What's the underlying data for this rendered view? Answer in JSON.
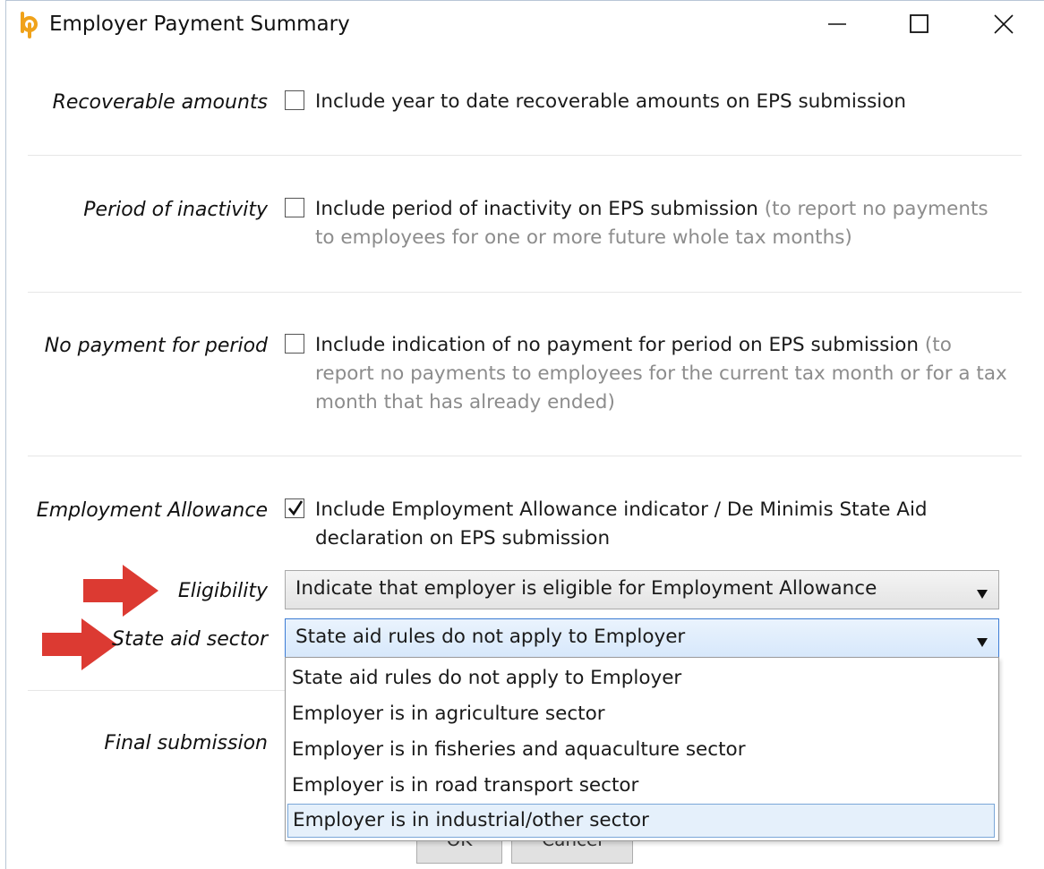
{
  "window": {
    "title": "Employer Payment Summary",
    "app_icon": "bp-logo-icon",
    "controls": [
      "minimize-icon",
      "maximize-icon",
      "close-icon"
    ]
  },
  "rows": {
    "recoverable": {
      "label": "Recoverable amounts",
      "checked": false,
      "text": "Include year to date recoverable amounts on EPS submission",
      "hint": ""
    },
    "inactivity": {
      "label": "Period of inactivity",
      "checked": false,
      "text": "Include period of inactivity on EPS submission",
      "hint": "(to report no payments to employees for one or more future whole tax months)"
    },
    "no_payment": {
      "label": "No payment for period",
      "checked": false,
      "text": "Include indication of no payment for period on EPS submission",
      "hint": "(to report no payments to employees for the current tax month or for a tax month that has already ended)"
    },
    "allowance": {
      "label": "Employment Allowance",
      "checked": true,
      "text": "Include Employment Allowance indicator / De Minimis State Aid declaration on EPS submission"
    },
    "eligibility": {
      "label": "Eligibility",
      "value": "Indicate that employer is eligible for Employment Allowance"
    },
    "state_aid": {
      "label": "State aid sector",
      "value": "State aid rules do not apply to Employer",
      "options": [
        "State aid rules do not apply to Employer",
        "Employer is in agriculture sector",
        "Employer is in fisheries and aquaculture sector",
        "Employer is in road transport sector",
        "Employer is in industrial/other sector"
      ],
      "highlighted_option": "Employer is in industrial/other sector"
    },
    "final": {
      "label": "Final submission"
    }
  },
  "buttons": {
    "ok": "OK",
    "cancel": "Cancel"
  },
  "colors": {
    "annotation_arrow": "#dc3a32",
    "hint_text": "#8c8c8c",
    "focus_border": "#3b7bd4"
  }
}
